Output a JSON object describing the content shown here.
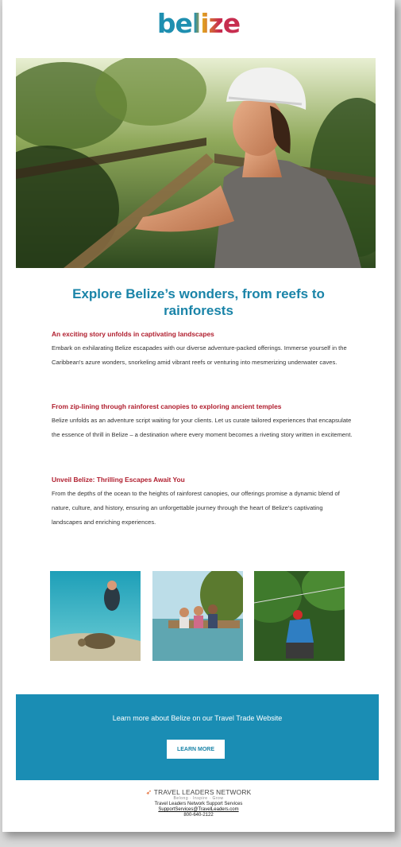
{
  "logo": {
    "text": "belize"
  },
  "hero": {
    "alt": "Woman in helmet on rope bridge in rainforest"
  },
  "headline": {
    "line1": "Explore Belize’s wonders, from reefs to",
    "line2": "rainforests"
  },
  "sections": [
    {
      "title": "An exciting story unfolds in captivating landscapes",
      "body": "Embark on exhilarating Belize escapades with our diverse adventure-packed offerings. Immerse yourself in the Caribbean's azure wonders, snorkeling amid vibrant reefs or venturing into mesmerizing underwater caves."
    },
    {
      "title": "From zip-lining through rainforest canopies to exploring ancient temples",
      "body": "Belize unfolds as an adventure script waiting for your clients. Let us curate tailored experiences that encapsulate the essence of thrill in Belize – a destination where every moment becomes a riveting story written in excitement."
    },
    {
      "title": "Unveil Belize: Thrilling Escapes Await You",
      "body": "From the depths of the ocean to the heights of rainforest canopies, our offerings promise a dynamic blend of nature, culture, and history, ensuring an unforgettable journey through the heart of Belize's captivating landscapes and enriching experiences."
    }
  ],
  "banner": {
    "text": "Learn more about Belize on our Travel Trade Website",
    "button": "LEARN MORE"
  },
  "footer": {
    "brand": "TRAVEL LEADERS NETWORK",
    "tagline": "Belong · Inspire · Grow",
    "support": "Travel Leaders Network Support Services",
    "email": "SupportServices@TravelLeaders.com",
    "phone": "800-640-2122"
  },
  "colors": {
    "accent": "#1a84a8",
    "section_title": "#b01e2e",
    "banner": "#1a8db4"
  }
}
